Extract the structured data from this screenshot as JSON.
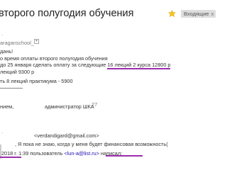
{
  "subject": "второго полугодия обучения",
  "label_chip": {
    "text": "Входящие",
    "close": "x"
  },
  "icons": {
    "star": "star-icon",
    "dropdown": "chevron-down-icon"
  },
  "colors": {
    "highlight": "#9b2fae",
    "chip_bg": "#dddddd"
  },
  "message1": {
    "sender_addr": "araganschool_",
    "dots": ".",
    "greeting": "дань!",
    "line1": "о время оплаты второго полугодия обучения",
    "line2_prefix": "до 25 января сделать оплату за следующие ",
    "line2_highlight": "16 лекций 2 курса 12800 р",
    "line3": "лекций 9300 р",
    "line4": "ть 8 лекций практикума - 5900",
    "signature_left": "нием,",
    "signature_role": "администратор ШКА",
    "signature_phone": ".                    27"
  },
  "message2": {
    "from_line": "<verdandigard@gmail.com>",
    "from_prefix": ".",
    "body_line": ", Я пока не знаю, когда у меня будет финансовая возможность(",
    "quote_date": "2018 г.",
    "quote_mid": " 1:39 пользователь ",
    "quote_email": "<lun-a@list.ru>",
    "quote_suffix": " написал:"
  }
}
